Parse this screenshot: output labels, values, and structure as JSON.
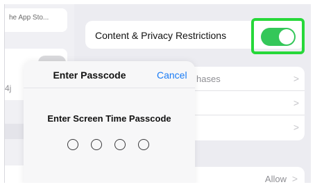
{
  "sidebar": {
    "top_text": "he App Sto...",
    "code_text": "4j"
  },
  "content_privacy": {
    "label": "Content & Privacy Restrictions",
    "toggle_on": true,
    "toggle_color": "#34c759",
    "highlight_color": "#27d83a"
  },
  "list": {
    "rows": [
      {
        "label": "hases",
        "chevron": ">"
      },
      {
        "label": "",
        "chevron": ">"
      },
      {
        "label": "",
        "chevron": ">"
      }
    ]
  },
  "allow_row": {
    "value": "Allow",
    "chevron": ">"
  },
  "dialog": {
    "title": "Enter Passcode",
    "cancel_label": "Cancel",
    "prompt": "Enter Screen Time Passcode",
    "digits_entered": 0,
    "digits_total": 4,
    "accent": "#1a7cf5"
  }
}
